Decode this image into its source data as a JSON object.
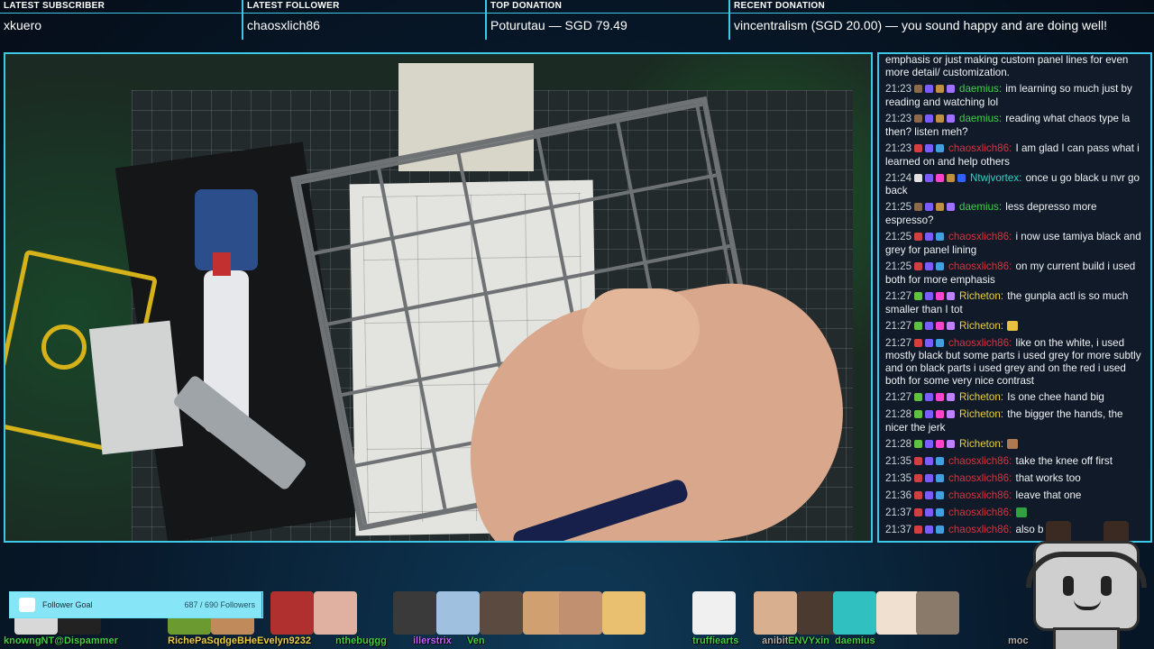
{
  "ticker": [
    {
      "label": "LATEST SUBSCRIBER",
      "value": "xkuero"
    },
    {
      "label": "LATEST FOLLOWER",
      "value": "chaosxlich86"
    },
    {
      "label": "TOP DONATION",
      "value": "Poturutau — SGD 79.49"
    },
    {
      "label": "RECENT DONATION",
      "value": "vincentralism (SGD 20.00) — you sound happy and are doing well!"
    }
  ],
  "colors": {
    "accent": "#3ec8e8",
    "panel": "#101a29",
    "goal_bar": "#1f9bb8"
  },
  "chat": {
    "messages": [
      {
        "time": "",
        "user": "",
        "color": "#ffffff",
        "badges": [],
        "text": "existing panel lines deeper or wider or both for more emphasis or just making custom panel lines for even more detail/ customization."
      },
      {
        "time": "21:23",
        "user": "daemius:",
        "color": "#40d048",
        "badges": [
          "#8a6a4a",
          "#7a5cff",
          "#c09040",
          "#a070ff"
        ],
        "text": "im learning so much just by reading and watching lol"
      },
      {
        "time": "21:23",
        "user": "daemius:",
        "color": "#40d048",
        "badges": [
          "#8a6a4a",
          "#7a5cff",
          "#c09040",
          "#a070ff"
        ],
        "text": "reading what chaos type la then? listen meh?"
      },
      {
        "time": "21:23",
        "user": "chaosxlich86:",
        "color": "#e0303c",
        "badges": [
          "#d04040",
          "#7a5cff",
          "#40a0e0"
        ],
        "text": "I am glad I can pass what i learned on and help others"
      },
      {
        "time": "21:24",
        "user": "Ntwjvortex:",
        "color": "#2fd4c4",
        "badges": [
          "#e0e0e0",
          "#7a5cff",
          "#ff44cc",
          "#c09040",
          "#3060ff"
        ],
        "text": "once u go black u nvr go back"
      },
      {
        "time": "21:25",
        "user": "daemius:",
        "color": "#40d048",
        "badges": [
          "#8a6a4a",
          "#7a5cff",
          "#c09040",
          "#a070ff"
        ],
        "text": "less depresso more espresso?"
      },
      {
        "time": "21:25",
        "user": "chaosxlich86:",
        "color": "#e0303c",
        "badges": [
          "#d04040",
          "#7a5cff",
          "#40a0e0"
        ],
        "text": "i now use tamiya black and grey for panel lining"
      },
      {
        "time": "21:25",
        "user": "chaosxlich86:",
        "color": "#e0303c",
        "badges": [
          "#d04040",
          "#7a5cff",
          "#40a0e0"
        ],
        "text": "on my current build i used both for more emphasis"
      },
      {
        "time": "21:27",
        "user": "Richeton:",
        "color": "#e8d048",
        "badges": [
          "#60c040",
          "#7a5cff",
          "#ff44cc",
          "#c080ff"
        ],
        "text": "the gunpla actl is so much smaller than I tot"
      },
      {
        "time": "21:27",
        "user": "Richeton:",
        "color": "#e8d048",
        "badges": [
          "#60c040",
          "#7a5cff",
          "#ff44cc",
          "#c080ff"
        ],
        "text": "",
        "emote": "#e8c040"
      },
      {
        "time": "21:27",
        "user": "chaosxlich86:",
        "color": "#e0303c",
        "badges": [
          "#d04040",
          "#7a5cff",
          "#40a0e0"
        ],
        "text": "like on the white, i used mostly black but some parts i used grey for more subtly and on black parts i used grey and on the red i used both for some very nice contrast"
      },
      {
        "time": "21:27",
        "user": "Richeton:",
        "color": "#e8d048",
        "badges": [
          "#60c040",
          "#7a5cff",
          "#ff44cc",
          "#c080ff"
        ],
        "text": "Is one chee hand big"
      },
      {
        "time": "21:28",
        "user": "Richeton:",
        "color": "#e8d048",
        "badges": [
          "#60c040",
          "#7a5cff",
          "#ff44cc",
          "#c080ff"
        ],
        "text": "the bigger the hands, the nicer the jerk"
      },
      {
        "time": "21:28",
        "user": "Richeton:",
        "color": "#e8d048",
        "badges": [
          "#60c040",
          "#7a5cff",
          "#ff44cc",
          "#c080ff"
        ],
        "text": "",
        "emote": "#b07a50"
      },
      {
        "time": "21:35",
        "user": "chaosxlich86:",
        "color": "#e0303c",
        "badges": [
          "#d04040",
          "#7a5cff",
          "#40a0e0"
        ],
        "text": "take the knee off first"
      },
      {
        "time": "21:35",
        "user": "chaosxlich86:",
        "color": "#e0303c",
        "badges": [
          "#d04040",
          "#7a5cff",
          "#40a0e0"
        ],
        "text": "that works too"
      },
      {
        "time": "21:36",
        "user": "chaosxlich86:",
        "color": "#e0303c",
        "badges": [
          "#d04040",
          "#7a5cff",
          "#40a0e0"
        ],
        "text": "leave that one"
      },
      {
        "time": "21:37",
        "user": "chaosxlich86:",
        "color": "#e0303c",
        "badges": [
          "#d04040",
          "#7a5cff",
          "#40a0e0"
        ],
        "text": "",
        "emote": "#30a040"
      },
      {
        "time": "21:37",
        "user": "chaosxlich86:",
        "color": "#e0303c",
        "badges": [
          "#d04040",
          "#7a5cff",
          "#40a0e0"
        ],
        "text": "also           b           g it"
      }
    ]
  },
  "goal": {
    "title": "Follower Goal",
    "count": "687 / 690 Followers",
    "progress": 0.9957
  },
  "supporters": [
    {
      "name": "knowngNT@Dispammer",
      "color": "#40d048"
    },
    {
      "name": "RichePaSqdgeBHeEvelyn9232",
      "color": "#e8d048"
    },
    {
      "name": "nthebuggg",
      "color": "#40d048"
    },
    {
      "name": "illerstrix",
      "color": "#c060ff"
    },
    {
      "name": "Ven",
      "color": "#40d048"
    },
    {
      "name": "truffiearts",
      "color": "#40d048"
    },
    {
      "name": "anibit",
      "color": "#b0b0b0"
    },
    {
      "name": "ENVYxin",
      "color": "#40d048"
    },
    {
      "name": "daemius",
      "color": "#40d048"
    },
    {
      "name": "moc",
      "color": "#b0b0b0"
    }
  ]
}
